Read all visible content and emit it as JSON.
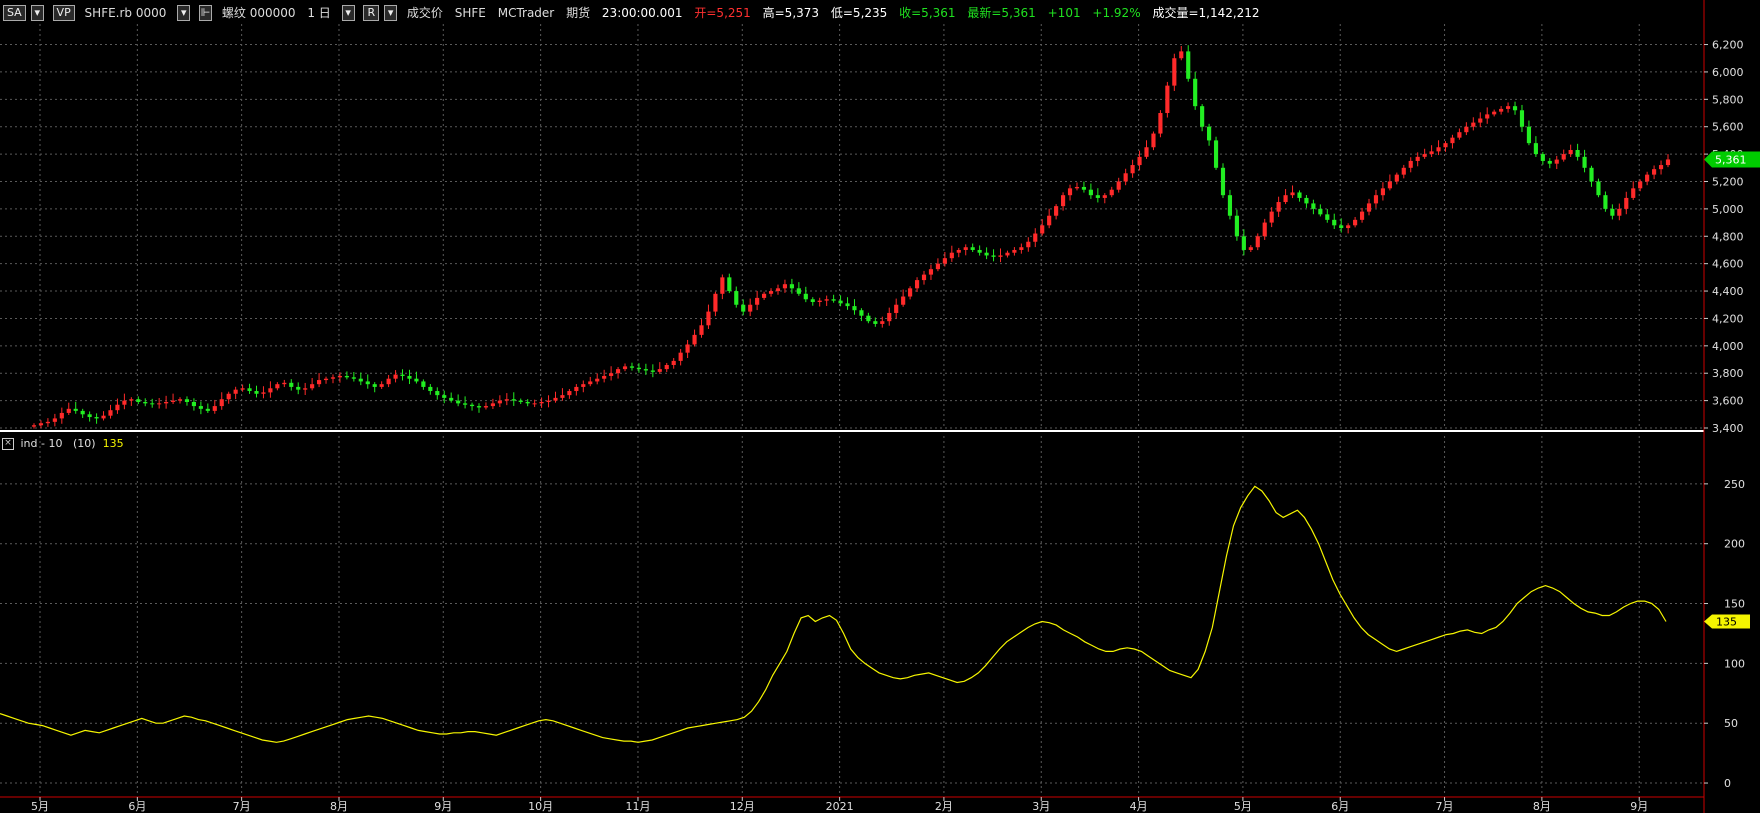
{
  "toolbar": {
    "symbol_btn": "SA",
    "vp_btn": "VP",
    "symbol": "SHFE.rb 0000",
    "name": "螺纹 000000",
    "interval": "1 日",
    "r_btn": "R",
    "price_type": "成交价",
    "exchange": "SHFE",
    "platform": "MCTrader",
    "category": "期货",
    "time": "23:00:00.001",
    "open_text": "开=5,251",
    "high_text": "高=5,373",
    "low_text": "低=5,235",
    "close_text": "收=5,361",
    "last_text": "最新=5,361",
    "change_text": "+101",
    "change_pct_text": "+1.92%",
    "volume_text": "成交量=1,142,212"
  },
  "indicator": {
    "close_icon": "×",
    "name": "ind - 10",
    "param": "(10)",
    "value": "135"
  },
  "price_badge": "5,361",
  "indicator_badge": "135",
  "colors": {
    "up": "#ff2a2a",
    "down": "#22ee22",
    "indicator_line": "#f5f500",
    "grid": "#5a5a5a",
    "axis_red": "#cc0000",
    "separator": "#ffffff"
  },
  "chart_data": [
    {
      "type": "candlestick",
      "y_ticks": [
        "3,400",
        "3,600",
        "3,800",
        "4,000",
        "4,200",
        "4,400",
        "4,600",
        "4,800",
        "5,000",
        "5,200",
        "5,400",
        "5,600",
        "5,800",
        "6,000",
        "6,200"
      ],
      "ylim": [
        3400,
        6350
      ],
      "x_tick_labels": [
        "5月",
        "6月",
        "7月",
        "8月",
        "9月",
        "10月",
        "11月",
        "12月",
        "2021",
        "2月",
        "3月",
        "4月",
        "5月",
        "6月",
        "7月",
        "8月",
        "9月"
      ],
      "close_series": [
        3420,
        3435,
        3445,
        3470,
        3510,
        3540,
        3525,
        3500,
        3480,
        3470,
        3490,
        3530,
        3570,
        3600,
        3610,
        3590,
        3580,
        3575,
        3580,
        3590,
        3600,
        3610,
        3590,
        3560,
        3540,
        3525,
        3560,
        3610,
        3650,
        3680,
        3690,
        3670,
        3650,
        3660,
        3690,
        3720,
        3730,
        3700,
        3680,
        3690,
        3720,
        3750,
        3760,
        3770,
        3780,
        3770,
        3760,
        3740,
        3720,
        3700,
        3720,
        3760,
        3790,
        3780,
        3760,
        3740,
        3700,
        3670,
        3640,
        3620,
        3600,
        3580,
        3570,
        3560,
        3550,
        3560,
        3580,
        3600,
        3610,
        3600,
        3590,
        3580,
        3580,
        3590,
        3600,
        3620,
        3640,
        3670,
        3700,
        3720,
        3740,
        3760,
        3780,
        3800,
        3830,
        3850,
        3840,
        3830,
        3820,
        3810,
        3830,
        3860,
        3890,
        3950,
        4010,
        4080,
        4150,
        4250,
        4380,
        4500,
        4400,
        4300,
        4250,
        4300,
        4350,
        4380,
        4400,
        4420,
        4450,
        4420,
        4380,
        4340,
        4320,
        4330,
        4340,
        4330,
        4310,
        4290,
        4260,
        4220,
        4180,
        4160,
        4180,
        4240,
        4300,
        4360,
        4420,
        4480,
        4520,
        4560,
        4600,
        4640,
        4680,
        4700,
        4720,
        4700,
        4680,
        4660,
        4650,
        4660,
        4680,
        4700,
        4720,
        4760,
        4820,
        4880,
        4950,
        5020,
        5100,
        5150,
        5160,
        5140,
        5100,
        5080,
        5100,
        5140,
        5200,
        5260,
        5320,
        5380,
        5450,
        5550,
        5700,
        5900,
        6100,
        6150,
        5950,
        5750,
        5600,
        5500,
        5300,
        5100,
        4950,
        4800,
        4700,
        4720,
        4800,
        4900,
        4980,
        5050,
        5100,
        5120,
        5080,
        5040,
        5000,
        4960,
        4920,
        4880,
        4860,
        4880,
        4920,
        4980,
        5040,
        5100,
        5150,
        5200,
        5250,
        5300,
        5350,
        5380,
        5400,
        5420,
        5450,
        5480,
        5520,
        5560,
        5600,
        5630,
        5660,
        5690,
        5710,
        5730,
        5750,
        5720,
        5600,
        5480,
        5400,
        5350,
        5330,
        5360,
        5400,
        5430,
        5380,
        5300,
        5200,
        5100,
        5000,
        4950,
        5000,
        5080,
        5150,
        5200,
        5250,
        5290,
        5320,
        5361
      ]
    },
    {
      "type": "line",
      "name": "ind - 10",
      "y_ticks": [
        "0",
        "50",
        "100",
        "150",
        "200",
        "250"
      ],
      "ylim": [
        -10,
        290
      ],
      "values": [
        58,
        56,
        54,
        52,
        50,
        49,
        48,
        46,
        44,
        42,
        40,
        42,
        44,
        43,
        42,
        44,
        46,
        48,
        50,
        52,
        54,
        52,
        50,
        50,
        52,
        54,
        56,
        55,
        53,
        52,
        50,
        48,
        46,
        44,
        42,
        40,
        38,
        36,
        35,
        34,
        35,
        37,
        39,
        41,
        43,
        45,
        47,
        49,
        51,
        53,
        54,
        55,
        56,
        55,
        54,
        52,
        50,
        48,
        46,
        44,
        43,
        42,
        41,
        41,
        42,
        42,
        43,
        43,
        42,
        41,
        40,
        42,
        44,
        46,
        48,
        50,
        52,
        53,
        52,
        50,
        48,
        46,
        44,
        42,
        40,
        38,
        37,
        36,
        35,
        35,
        34,
        35,
        36,
        38,
        40,
        42,
        44,
        46,
        47,
        48,
        49,
        50,
        51,
        52,
        53,
        55,
        60,
        68,
        78,
        90,
        100,
        110,
        125,
        138,
        140,
        135,
        138,
        140,
        136,
        125,
        112,
        105,
        100,
        96,
        92,
        90,
        88,
        87,
        88,
        90,
        91,
        92,
        90,
        88,
        86,
        84,
        85,
        88,
        92,
        98,
        105,
        112,
        118,
        122,
        126,
        130,
        133,
        135,
        134,
        132,
        128,
        125,
        122,
        118,
        115,
        112,
        110,
        110,
        112,
        113,
        112,
        110,
        106,
        102,
        98,
        94,
        92,
        90,
        88,
        95,
        110,
        130,
        160,
        190,
        215,
        230,
        240,
        248,
        244,
        236,
        226,
        222,
        225,
        228,
        222,
        212,
        200,
        185,
        170,
        158,
        148,
        138,
        130,
        124,
        120,
        116,
        112,
        110,
        112,
        114,
        116,
        118,
        120,
        122,
        124,
        125,
        127,
        128,
        126,
        125,
        128,
        130,
        135,
        142,
        150,
        155,
        160,
        163,
        165,
        163,
        160,
        155,
        150,
        146,
        143,
        142,
        140,
        140,
        143,
        147,
        150,
        152,
        152,
        150,
        145,
        135
      ]
    }
  ]
}
